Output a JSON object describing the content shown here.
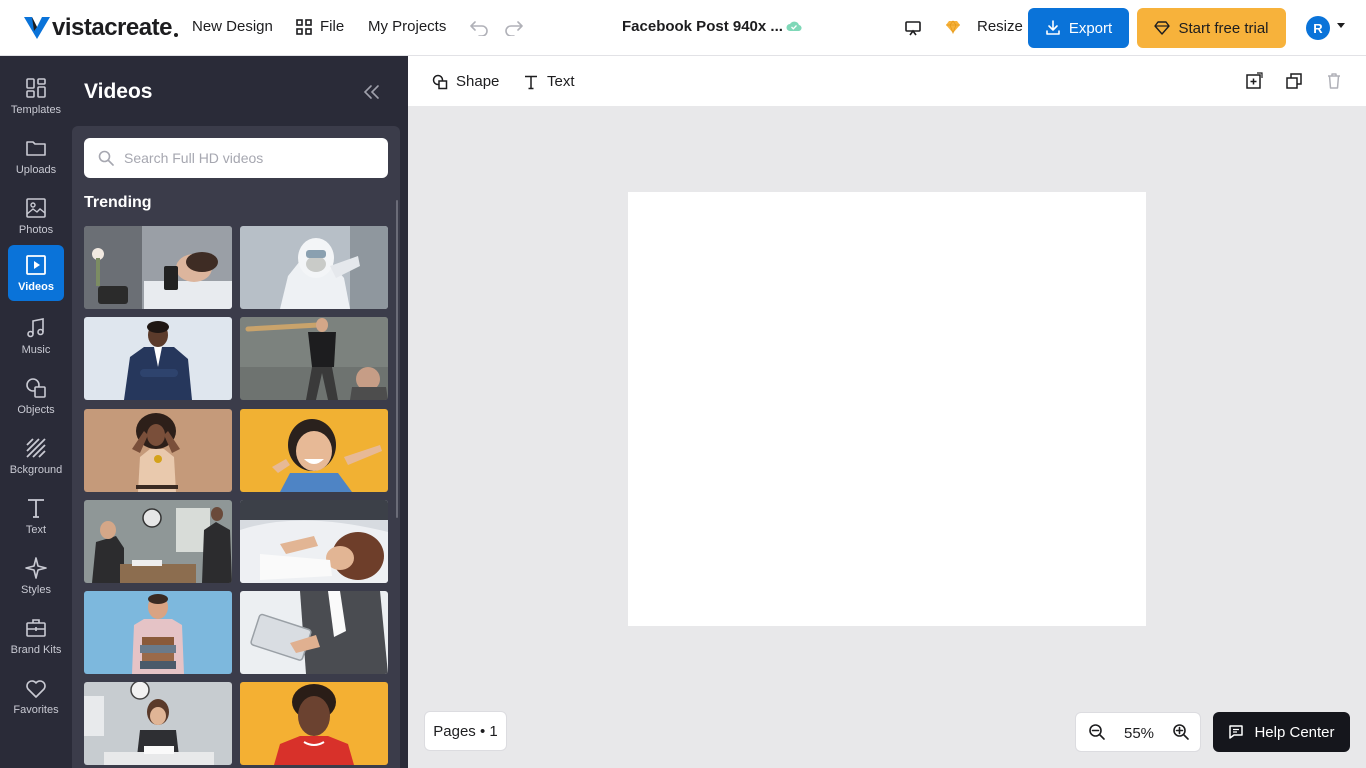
{
  "app": {
    "logo_text": "vistacreate",
    "brand_color": "#0a73d9"
  },
  "topbar": {
    "new_design": "New Design",
    "file": "File",
    "my_projects": "My Projects",
    "doc_title": "Facebook Post 940x ...",
    "resize": "Resize",
    "export": "Export",
    "trial": "Start free trial",
    "avatar_initial": "R",
    "trial_color": "#f7b23b"
  },
  "rail": {
    "items": [
      {
        "label": "Templates",
        "icon": "templates-icon"
      },
      {
        "label": "Uploads",
        "icon": "folder-icon"
      },
      {
        "label": "Photos",
        "icon": "photo-icon"
      },
      {
        "label": "Videos",
        "icon": "video-icon",
        "active": true
      },
      {
        "label": "Music",
        "icon": "music-icon"
      },
      {
        "label": "Objects",
        "icon": "objects-icon"
      },
      {
        "label": "Bckground",
        "icon": "background-icon"
      },
      {
        "label": "Text",
        "icon": "text-icon"
      },
      {
        "label": "Styles",
        "icon": "sparkle-icon"
      },
      {
        "label": "Brand Kits",
        "icon": "briefcase-icon"
      },
      {
        "label": "Favorites",
        "icon": "heart-icon"
      }
    ]
  },
  "panel": {
    "title": "Videos",
    "search_placeholder": "Search Full HD videos",
    "section": "Trending",
    "thumbnails": [
      "woman-in-bed-with-phone",
      "person-in-hazmat-suit",
      "businessman-checking-watch",
      "man-with-baseball-bat",
      "woman-with-headache",
      "smiling-girl-yellow-background",
      "business-meeting-office",
      "woman-lying-on-pillow",
      "man-holding-books",
      "businesswoman-with-tablet",
      "woman-at-desk-with-clock",
      "man-red-shirt-yellow-background"
    ]
  },
  "canvas_toolbar": {
    "shape": "Shape",
    "text": "Text"
  },
  "footer": {
    "pages": "Pages • 1",
    "zoom": "55%",
    "help": "Help Center"
  }
}
